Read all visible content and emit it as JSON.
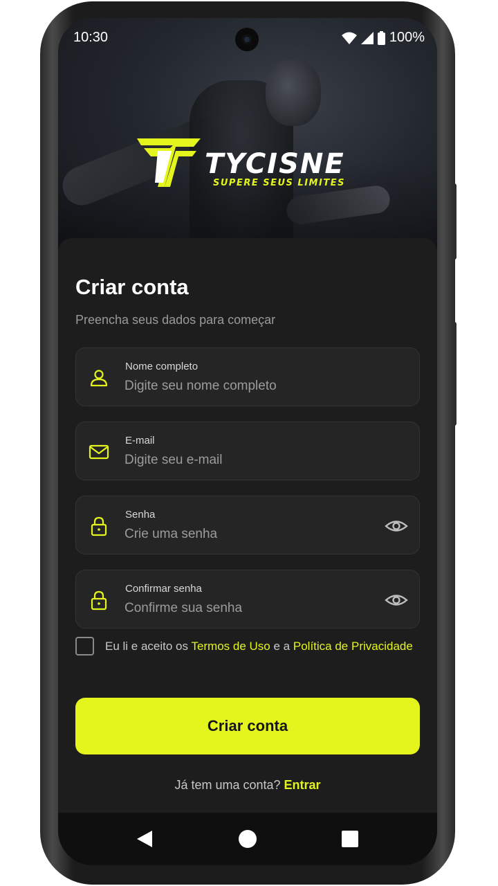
{
  "status_bar": {
    "time": "10:30",
    "battery": "100%",
    "icons": [
      "wifi-icon",
      "signal-icon",
      "battery-icon"
    ]
  },
  "brand": {
    "name": "TYCISNE",
    "tagline": "SUPERE SEUS LIMITES",
    "accent_color": "#e4f51e"
  },
  "form": {
    "title": "Criar conta",
    "subtitle": "Preencha seus dados para começar",
    "fields": [
      {
        "label": "Nome completo",
        "placeholder": "Digite seu nome completo",
        "icon": "user-icon"
      },
      {
        "label": "E-mail",
        "placeholder": "Digite seu e-mail",
        "icon": "mail-icon"
      },
      {
        "label": "Senha",
        "placeholder": "Crie uma senha",
        "icon": "lock-icon",
        "toggle_icon": "eye-icon"
      },
      {
        "label": "Confirmar senha",
        "placeholder": "Confirme sua senha",
        "icon": "lock-icon",
        "toggle_icon": "eye-icon"
      }
    ],
    "terms": {
      "prefix": "Eu li e aceito os",
      "terms_link": "Termos de Uso",
      "connector": "e a",
      "privacy_link": "Política de Privacidade",
      "checked": false
    },
    "submit_label": "Criar conta",
    "login_prompt": "Já tem uma conta?",
    "login_link": "Entrar"
  },
  "nav_bar": {
    "buttons": [
      "back-icon",
      "home-icon",
      "recents-icon"
    ]
  }
}
